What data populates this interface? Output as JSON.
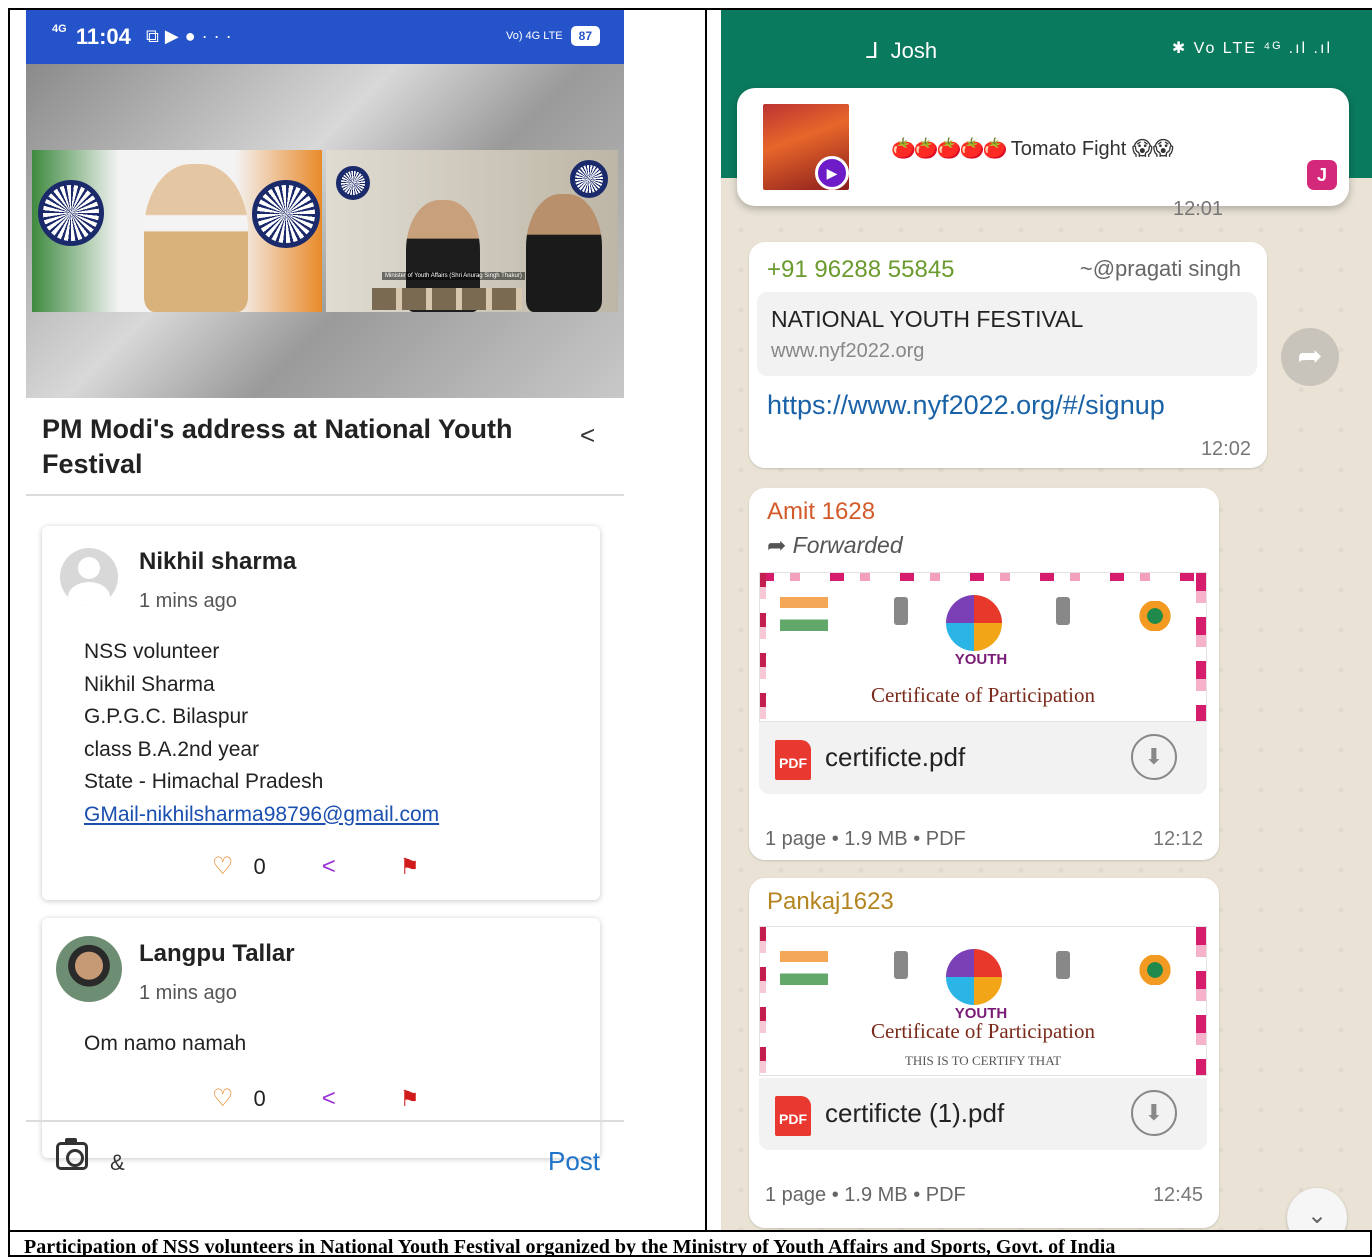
{
  "left_phone": {
    "status_bar": {
      "network": "4G",
      "time": "11:04",
      "icons_right": "Vo) 4G LTE",
      "battery": "87",
      "overflow": "···"
    },
    "video": {
      "caption_tag": "Minister of Youth Affairs (Shri Anurag Singh Thakur)"
    },
    "post_title": "PM Modi's address at National Youth Festival",
    "comments": [
      {
        "name": "Nikhil sharma",
        "time": "1 mins ago",
        "lines": [
          "NSS volunteer",
          "Nikhil Sharma",
          "G.P.G.C. Bilaspur",
          "class B.A.2nd year",
          "State - Himachal Pradesh"
        ],
        "email_line": "GMail-nikhilsharma98796@gmail.com",
        "likes": "0"
      },
      {
        "name": "Langpu Tallar",
        "time": "1 mins ago",
        "lines": [
          "Om namo namah"
        ],
        "likes": "0"
      }
    ],
    "composer": {
      "text": "&",
      "post_label": "Post"
    }
  },
  "right_phone": {
    "status_bar": {
      "app": "Josh",
      "icons": "✱ Vo LTE ⁴ᴳ .ıl .ıl"
    },
    "notification": {
      "text": "Tomato Fight",
      "emoji": "🍅🍅🍅🍅🍅",
      "badge": "J"
    },
    "peek_time": "12:01",
    "messages": [
      {
        "sender": "+91 96288 55845",
        "mention": "~@pragati singh",
        "link_title": "NATIONAL YOUTH FESTIVAL",
        "link_domain": "www.nyf2022.org",
        "link": "https://www.nyf2022.org/#/signup",
        "time": "12:02"
      },
      {
        "sender": "Amit 1628",
        "forwarded": "Forwarded",
        "cert_title": "Certificate of Participation",
        "cert_youth": "YOUTH",
        "file": "certificte.pdf",
        "file_icon": "PDF",
        "meta": "1 page • 1.9 MB • PDF",
        "time": "12:12"
      },
      {
        "sender": "Pankaj1623",
        "cert_title": "Certificate of Participation",
        "cert_line": "THIS IS TO CERTIFY THAT",
        "cert_youth": "YOUTH",
        "file": "certificte (1).pdf",
        "file_icon": "PDF",
        "meta": "1 page • 1.9 MB • PDF",
        "time": "12:45"
      }
    ]
  },
  "caption": "Participation of NSS volunteers in National Youth Festival organized by the Ministry of Youth Affairs and Sports, Govt. of India"
}
